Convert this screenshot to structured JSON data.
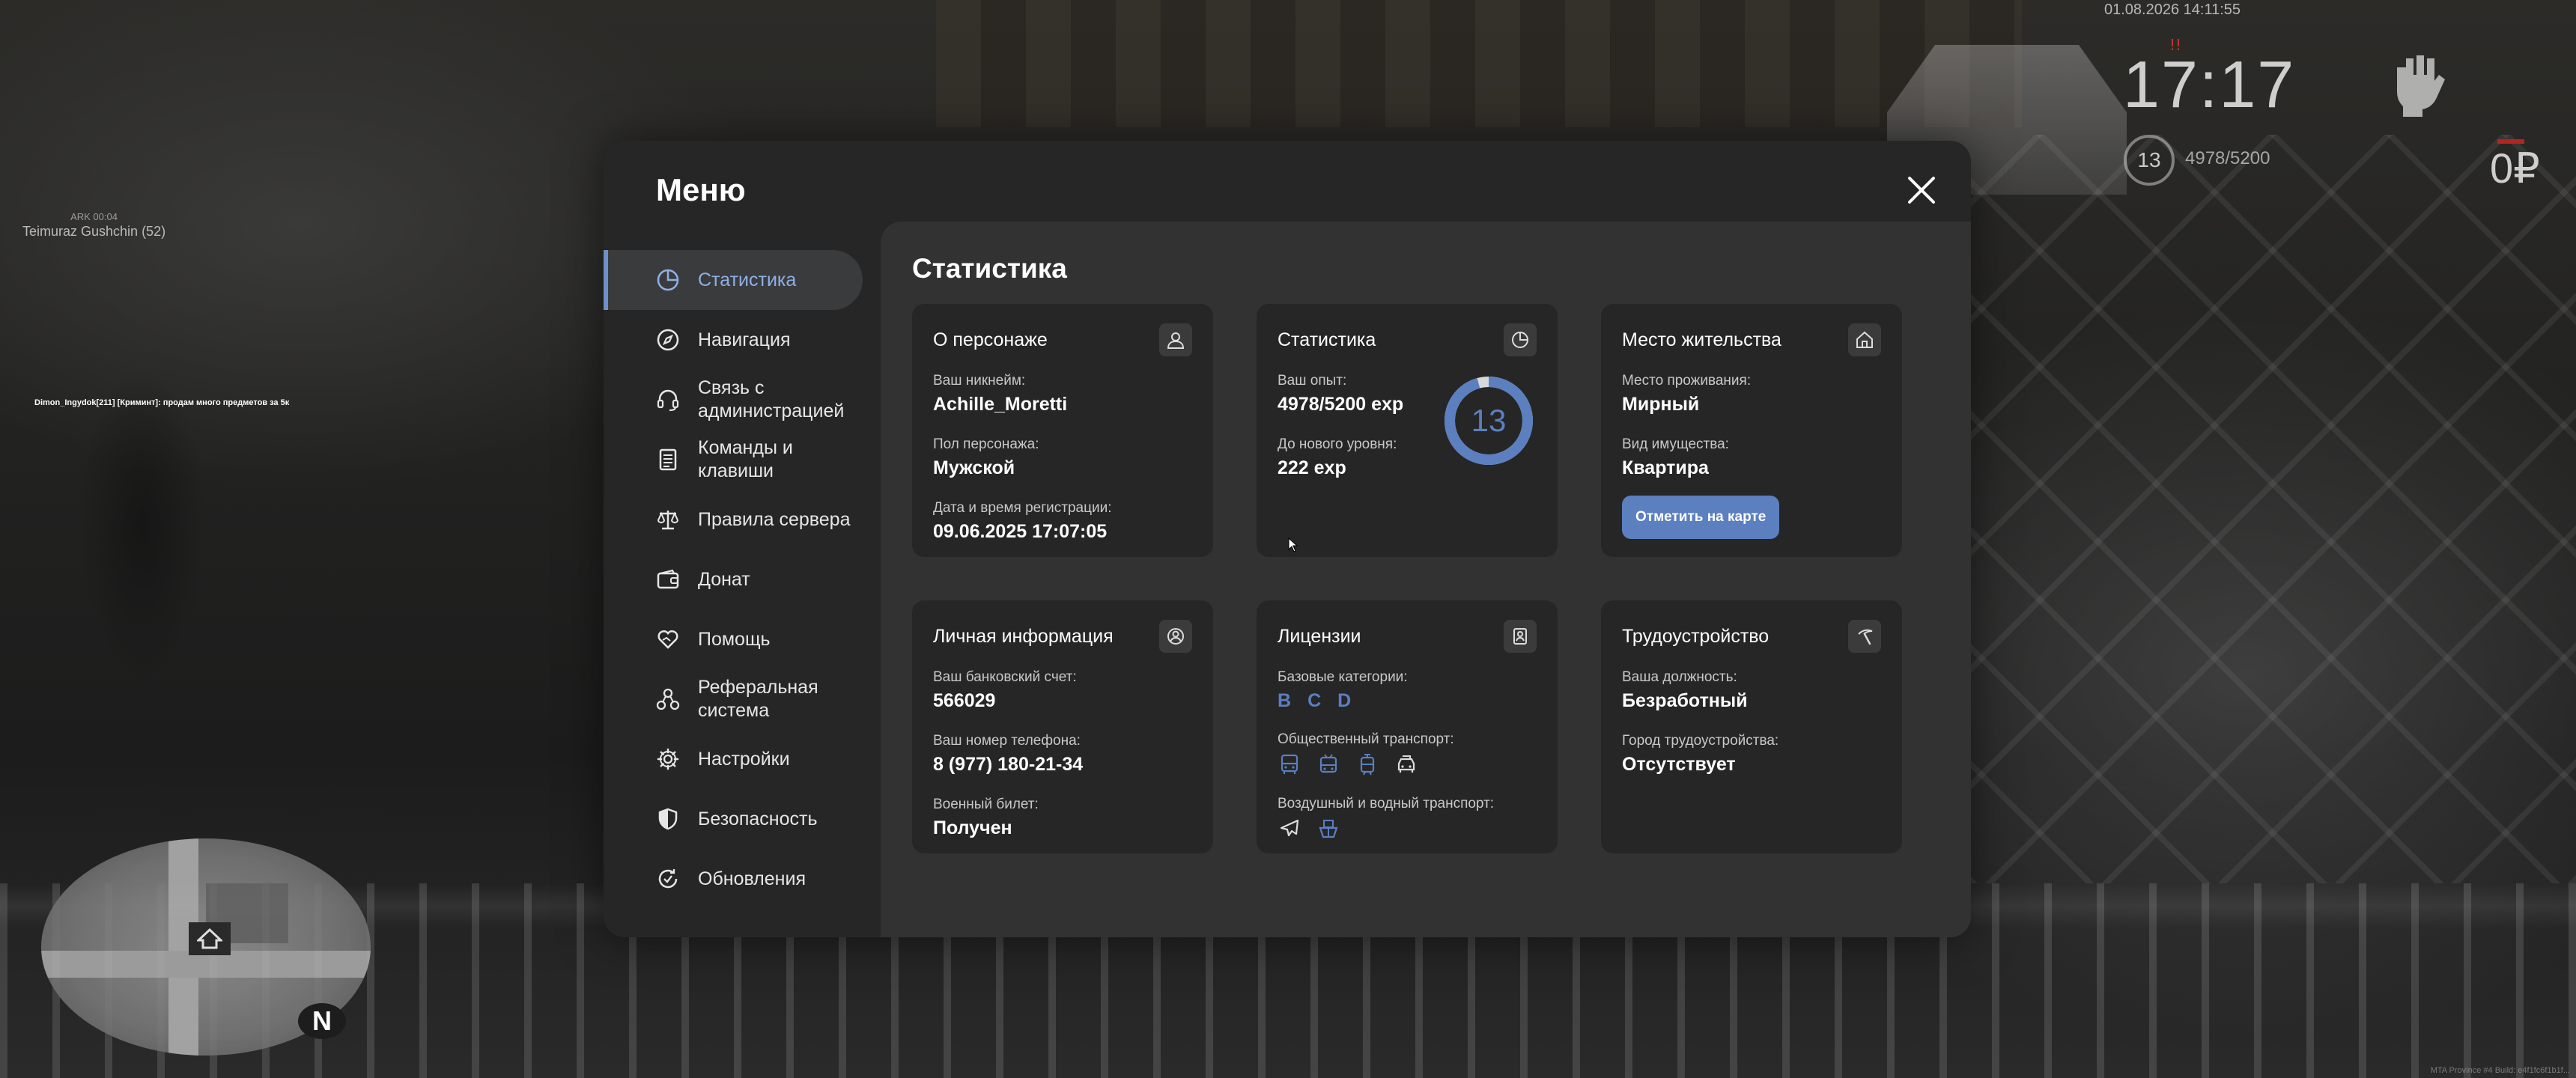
{
  "hud": {
    "datetime": "01.08.2026 14:11:55",
    "clock": "17:17",
    "level": "13",
    "exp": "4978/5200",
    "money": "0₽",
    "red_marker": "!!"
  },
  "world": {
    "player_tag_small": "ARK 00:04",
    "player_tag_name": "Teimuraz Gushchin (52)",
    "chat_line": "Dimon_Ingydok[211] [Криминт]: продам много предметов за 5к",
    "minimap_north": "N",
    "build_info": "MTA Province #4 Build: e4f1fc6f1b1f..."
  },
  "modal": {
    "title": "Меню",
    "nav": [
      {
        "label": "Статистика",
        "icon": "pie-chart-icon"
      },
      {
        "label": "Навигация",
        "icon": "compass-icon"
      },
      {
        "label": "Связь с администрацией",
        "icon": "headset-icon"
      },
      {
        "label": "Команды и клавиши",
        "icon": "document-icon"
      },
      {
        "label": "Правила сервера",
        "icon": "scales-icon"
      },
      {
        "label": "Донат",
        "icon": "wallet-icon"
      },
      {
        "label": "Помощь",
        "icon": "heart-hand-icon"
      },
      {
        "label": "Реферальная система",
        "icon": "network-icon"
      },
      {
        "label": "Настройки",
        "icon": "gear-icon"
      },
      {
        "label": "Безопасность",
        "icon": "shield-icon"
      },
      {
        "label": "Обновления",
        "icon": "refresh-check-icon"
      }
    ],
    "active_nav": "Статистика",
    "content_title": "Статистика",
    "cards": {
      "character": {
        "title": "О персонаже",
        "nickname_label": "Ваш никнейм:",
        "nickname": "Achille_Moretti",
        "gender_label": "Пол персонажа:",
        "gender": "Мужской",
        "reg_label": "Дата и время регистрации:",
        "reg_value": "09.06.2025 17:07:05"
      },
      "stats": {
        "title": "Статистика",
        "exp_label": "Ваш опыт:",
        "exp_value": "4978/5200 exp",
        "next_label": "До нового уровня:",
        "next_value": "222 exp",
        "level": "13",
        "progress": 0.957
      },
      "residence": {
        "title": "Место жительства",
        "place_label": "Место проживания:",
        "place_value": "Мирный",
        "property_label": "Вид имущества:",
        "property_value": "Квартира",
        "map_button": "Отметить на карте"
      },
      "personal": {
        "title": "Личная информация",
        "bank_label": "Ваш банковский счет:",
        "bank_value": "566029",
        "phone_label": "Ваш номер телефона:",
        "phone_value": "8 (977) 180-21-34",
        "military_label": "Военный билет:",
        "military_value": "Получен"
      },
      "licenses": {
        "title": "Лицензии",
        "base_label": "Базовые категории:",
        "base_categories": [
          "B",
          "C",
          "D"
        ],
        "public_label": "Общественный транспорт:",
        "public_icons": [
          "bus-icon",
          "trolleybus-icon",
          "tram-icon",
          "taxi-icon"
        ],
        "air_label": "Воздушный и водный транспорт:",
        "air_icons": [
          "airplane-icon",
          "boat-icon"
        ]
      },
      "job": {
        "title": "Трудоустройство",
        "position_label": "Ваша должность:",
        "position_value": "Безработный",
        "city_label": "Город трудоустройства:",
        "city_value": "Отсутствует"
      }
    }
  },
  "colors": {
    "accent": "#5b7fbf",
    "modal_bg": "#262626",
    "content_bg": "#323232"
  }
}
